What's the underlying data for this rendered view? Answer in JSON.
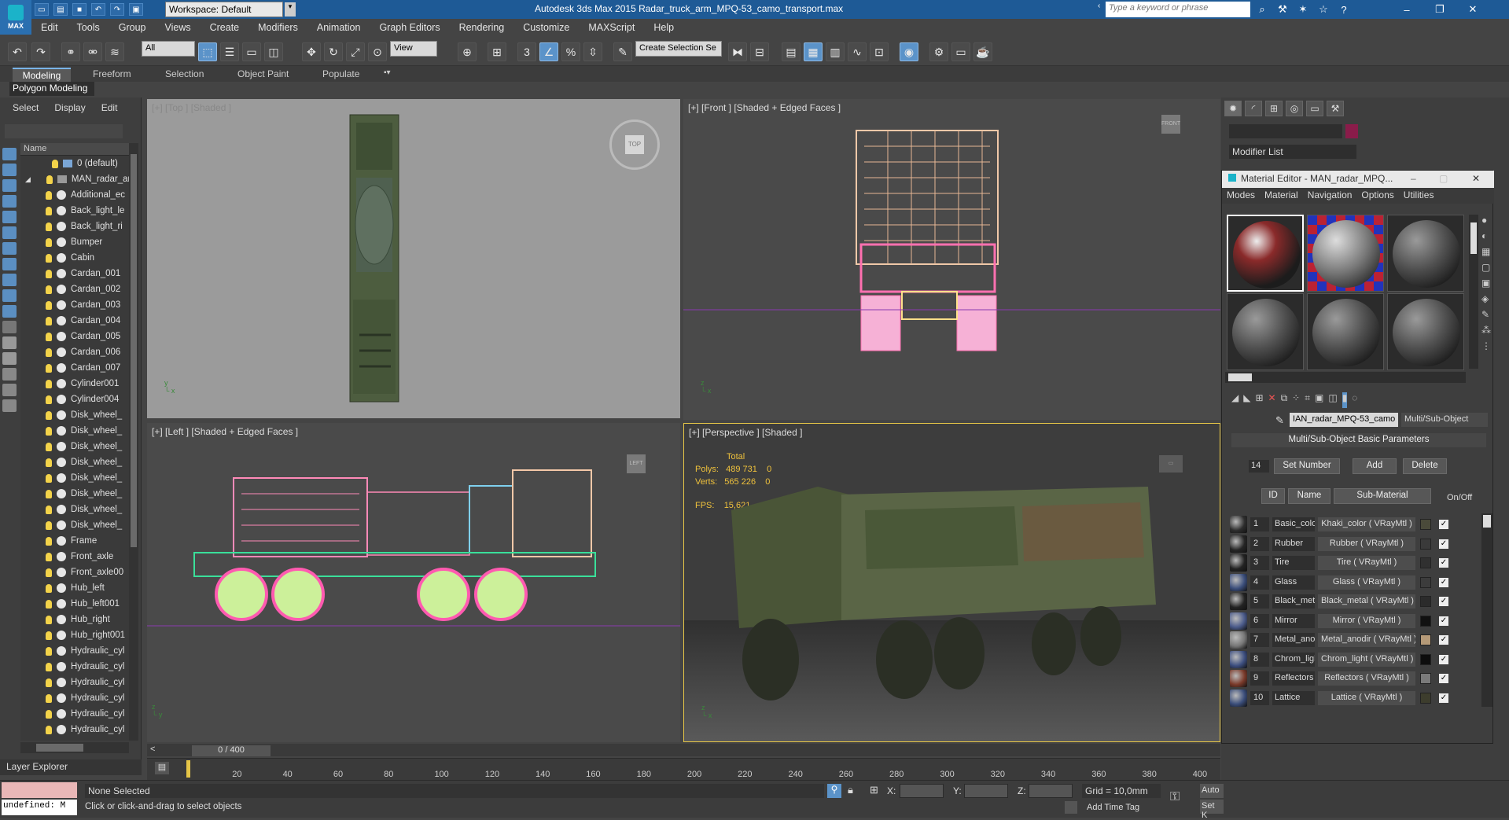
{
  "app": {
    "logo_label": "MAX",
    "workspace": "Workspace: Default",
    "title": "Autodesk 3ds Max 2015    Radar_truck_arm_MPQ-53_camo_transport.max",
    "search_placeholder": "Type a keyword or phrase"
  },
  "menu": [
    "Edit",
    "Tools",
    "Group",
    "Views",
    "Create",
    "Modifiers",
    "Animation",
    "Graph Editors",
    "Rendering",
    "Customize",
    "MAXScript",
    "Help"
  ],
  "toolbar": {
    "filter": "All",
    "refcoord": "View",
    "selection_set": "Create Selection Se",
    "snap_label": "3"
  },
  "ribbon": {
    "tabs": [
      "Modeling",
      "Freeform",
      "Selection",
      "Object Paint",
      "Populate"
    ],
    "sub": "Polygon Modeling"
  },
  "scene_explorer": {
    "menu": [
      "Select",
      "Display",
      "Edit"
    ],
    "column": "Name",
    "layer": "0 (default)",
    "group": "MAN_radar_arm",
    "items": [
      "Additional_ec",
      "Back_light_le",
      "Back_light_ri",
      "Bumper",
      "Cabin",
      "Cardan_001",
      "Cardan_002",
      "Cardan_003",
      "Cardan_004",
      "Cardan_005",
      "Cardan_006",
      "Cardan_007",
      "Cylinder001",
      "Cylinder004",
      "Disk_wheel_",
      "Disk_wheel_",
      "Disk_wheel_",
      "Disk_wheel_",
      "Disk_wheel_",
      "Disk_wheel_",
      "Disk_wheel_",
      "Disk_wheel_",
      "Frame",
      "Front_axle",
      "Front_axle00",
      "Hub_left",
      "Hub_left001",
      "Hub_right",
      "Hub_right001",
      "Hydraulic_cyl",
      "Hydraulic_cyl",
      "Hydraulic_cyl",
      "Hydraulic_cyl",
      "Hydraulic_cyl",
      "Hydraulic_cyl"
    ],
    "footer": "Layer Explorer"
  },
  "viewports": {
    "top": "[+] [Top ] [Shaded ]",
    "front": "[+] [Front ] [Shaded + Edged Faces ]",
    "left": "[+] [Left ] [Shaded + Edged Faces ]",
    "persp": "[+] [Perspective ] [Shaded ]",
    "stats": {
      "total_label": "Total",
      "polys_label": "Polys:",
      "polys": "489 731",
      "polys_sel": "0",
      "verts_label": "Verts:",
      "verts": "565 226",
      "verts_sel": "0",
      "fps_label": "FPS:",
      "fps": "15,621"
    },
    "cube_top": "TOP",
    "cube_front": "FRONT",
    "cube_left": "LEFT"
  },
  "timeline": {
    "frame_counter": "0 / 400",
    "ticks": [
      "20",
      "40",
      "60",
      "80",
      "100",
      "120",
      "140",
      "160",
      "180",
      "200",
      "220",
      "240",
      "260",
      "280",
      "300",
      "320",
      "340",
      "360",
      "380",
      "400"
    ]
  },
  "status": {
    "maxscript": "undefined: M",
    "selection": "None Selected",
    "prompt": "Click or click-and-drag to select objects",
    "x_label": "X:",
    "y_label": "Y:",
    "z_label": "Z:",
    "grid": "Grid = 10,0mm",
    "add_time_tag": "Add Time Tag",
    "auto": "Auto",
    "set": "Set K"
  },
  "command_panel": {
    "modifier_list": "Modifier List"
  },
  "material_editor": {
    "title": "Material Editor - MAN_radar_MPQ...",
    "menu": [
      "Modes",
      "Material",
      "Navigation",
      "Options",
      "Utilities"
    ],
    "material_name": "IAN_radar_MPQ-53_camo",
    "material_type": "Multi/Sub-Object",
    "rollout": "Multi/Sub-Object Basic Parameters",
    "count": "14",
    "set_number": "Set Number",
    "add": "Add",
    "delete": "Delete",
    "col_id": "ID",
    "col_name": "Name",
    "col_sub": "Sub-Material",
    "col_onoff": "On/Off",
    "rows": [
      {
        "id": "1",
        "name": "Basic_color",
        "sub": "Khaki_color  ( VRayMtl )",
        "swatch": "#4a4a3a",
        "thumb": "#2d2d2d"
      },
      {
        "id": "2",
        "name": "Rubber",
        "sub": "Rubber  ( VRayMtl )",
        "swatch": "#3a3a3a",
        "thumb": "#252525"
      },
      {
        "id": "3",
        "name": "Tire",
        "sub": "Tire  ( VRayMtl )",
        "swatch": "#303030",
        "thumb": "#222"
      },
      {
        "id": "4",
        "name": "Glass",
        "sub": "Glass  ( VRayMtl )",
        "swatch": "#3c3c3c",
        "thumb": "#3a4d7a"
      },
      {
        "id": "5",
        "name": "Black_metal",
        "sub": "Black_metal  ( VRayMtl )",
        "swatch": "#2b2b2b",
        "thumb": "#222"
      },
      {
        "id": "6",
        "name": "Mirror",
        "sub": "Mirror  ( VRayMtl )",
        "swatch": "#111111",
        "thumb": "#4a5a8a"
      },
      {
        "id": "7",
        "name": "Metal_anod",
        "sub": "Metal_anodir  ( VRayMtl )",
        "swatch": "#b59a78",
        "thumb": "#777"
      },
      {
        "id": "8",
        "name": "Chrom_light",
        "sub": "Chrom_light  ( VRayMtl )",
        "swatch": "#0d0d0d",
        "thumb": "#3d4f80"
      },
      {
        "id": "9",
        "name": "Reflectors",
        "sub": "Reflectors  ( VRayMtl )",
        "swatch": "#7a7a7a",
        "thumb": "#7a3a2a"
      },
      {
        "id": "10",
        "name": "Lattice",
        "sub": "Lattice  ( VRayMtl )",
        "swatch": "#3d3d2d",
        "thumb": "#3a4d7a"
      }
    ]
  }
}
